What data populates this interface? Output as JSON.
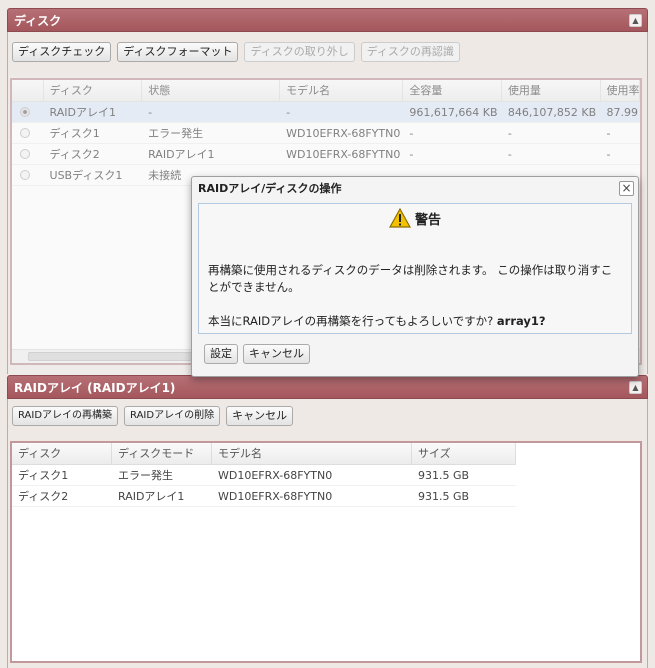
{
  "disk_panel": {
    "title": "ディスク",
    "collapse_icon": "▲",
    "toolbar": [
      "ディスクチェック",
      "ディスクフォーマット",
      "ディスクの取り外し",
      "ディスクの再認識"
    ],
    "columns": [
      "ディスク",
      "状態",
      "モデル名",
      "全容量",
      "使用量",
      "使用率"
    ],
    "rows": [
      {
        "disk": "RAIDアレイ1",
        "status": "-",
        "model": "-",
        "capacity": "961,617,664 KB",
        "used": "846,107,852 KB",
        "usage": "87.99"
      },
      {
        "disk": "ディスク1",
        "status": "エラー発生",
        "model": "WD10EFRX-68FYTN0",
        "capacity": "-",
        "used": "-",
        "usage": "-"
      },
      {
        "disk": "ディスク2",
        "status": "RAIDアレイ1",
        "model": "WD10EFRX-68FYTN0",
        "capacity": "-",
        "used": "-",
        "usage": "-"
      },
      {
        "disk": "USBディスク1",
        "status": "未接続",
        "model": "",
        "capacity": "",
        "used": "",
        "usage": ""
      }
    ]
  },
  "raid_panel": {
    "title": "RAIDアレイ (RAIDアレイ1)",
    "toolbar": [
      "RAIDアレイの再構築",
      "RAIDアレイの削除",
      "キャンセル"
    ],
    "columns": [
      "ディスク",
      "ディスクモード",
      "モデル名",
      "サイズ"
    ],
    "rows": [
      {
        "disk": "ディスク1",
        "mode": "エラー発生",
        "model": "WD10EFRX-68FYTN0",
        "size": "931.5 GB"
      },
      {
        "disk": "ディスク2",
        "mode": "RAIDアレイ1",
        "model": "WD10EFRX-68FYTN0",
        "size": "931.5 GB"
      }
    ]
  },
  "dialog": {
    "title": "RAIDアレイ/ディスクの操作",
    "close_icon": "×",
    "warning_title": "警告",
    "message": "再構築に使用されるディスクのデータは削除されます。 この操作は取り消すことができません。",
    "question": "本当にRAIDアレイの再構築を行ってもよろしいですか?",
    "target": "array1?",
    "ok_label": "設定",
    "cancel_label": "キャンセル"
  },
  "colors": {
    "header": "#a95e63",
    "selected_row": "#dfe8f6",
    "warning": "#f2c200"
  }
}
